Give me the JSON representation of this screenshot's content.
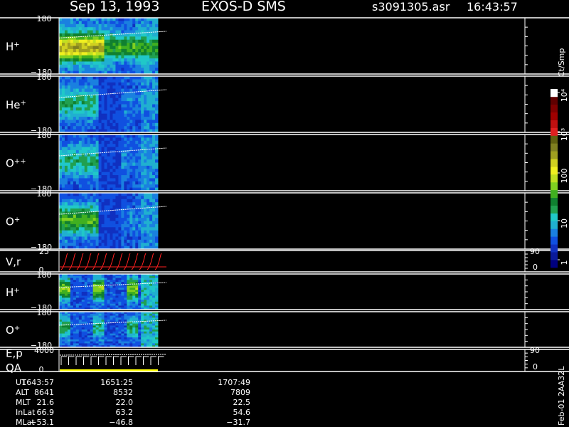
{
  "header": {
    "date": "Sep 13, 1993",
    "instrument": "EXOS-D SMS",
    "file": "s3091305.asr",
    "time": "16:43:57"
  },
  "colorbar": {
    "unit": "Ct/Smp",
    "ticks": [
      "1",
      "10",
      "100",
      "10³",
      "10⁴"
    ],
    "colors": [
      "#000080",
      "#0a1a9a",
      "#1030c0",
      "#1050e0",
      "#1a80e0",
      "#20b0d0",
      "#20c8c8",
      "#20a050",
      "#108030",
      "#40b020",
      "#80d020",
      "#c0e020",
      "#f0f020",
      "#d0d020",
      "#a0a020",
      "#808020",
      "#606010",
      "#e02020",
      "#c01010",
      "#a00000",
      "#800000",
      "#600000",
      "#ffffff"
    ]
  },
  "colors": {
    "axis": "#ffffff",
    "trace": "#ffffff",
    "velocity": "#ff2020",
    "qa": "#ffff00",
    "background": "#000000"
  },
  "chart_data": {
    "type": "heatmap",
    "panels": [
      {
        "label": "H",
        "superscript": "+",
        "ymax": "180",
        "ymin": "−180"
      },
      {
        "label": "He",
        "superscript": "+",
        "ymax": "180",
        "ymin": "−180"
      },
      {
        "label": "O",
        "superscript": "++",
        "ymax": "180",
        "ymin": "−180"
      },
      {
        "label": "O",
        "superscript": "+",
        "ymax": "180",
        "ymin": "−180"
      },
      {
        "label": "V,r",
        "superscript": "",
        "ymax": "25",
        "ymin": "0",
        "right_max": "90",
        "right_min": "0"
      },
      {
        "label": "H",
        "superscript": "+",
        "ymax": "180",
        "ymin": "−180"
      },
      {
        "label": "O",
        "superscript": "+",
        "ymax": "180",
        "ymin": "−180"
      },
      {
        "label": "E,p",
        "superscript": "",
        "label2": "QA",
        "ymax": "4000",
        "ymin": "0",
        "right_max": "90",
        "right_min": "0"
      }
    ],
    "x_ticks": [
      "1643:57",
      "1651:25",
      "1707:49"
    ],
    "orbit_table": [
      {
        "name": "UT",
        "values": [
          "1643:57",
          "1651:25",
          "1707:49"
        ]
      },
      {
        "name": "ALT",
        "values": [
          "8641",
          "8532",
          "7809"
        ]
      },
      {
        "name": "MLT",
        "values": [
          "21.6",
          "22.0",
          "22.5"
        ]
      },
      {
        "name": "InLat",
        "values": [
          "66.9",
          "63.2",
          "54.6"
        ]
      },
      {
        "name": "MLat",
        "values": [
          "−53.1",
          "−46.8",
          "−31.7"
        ]
      }
    ],
    "side_label": "Feb-01 2AA32L"
  }
}
